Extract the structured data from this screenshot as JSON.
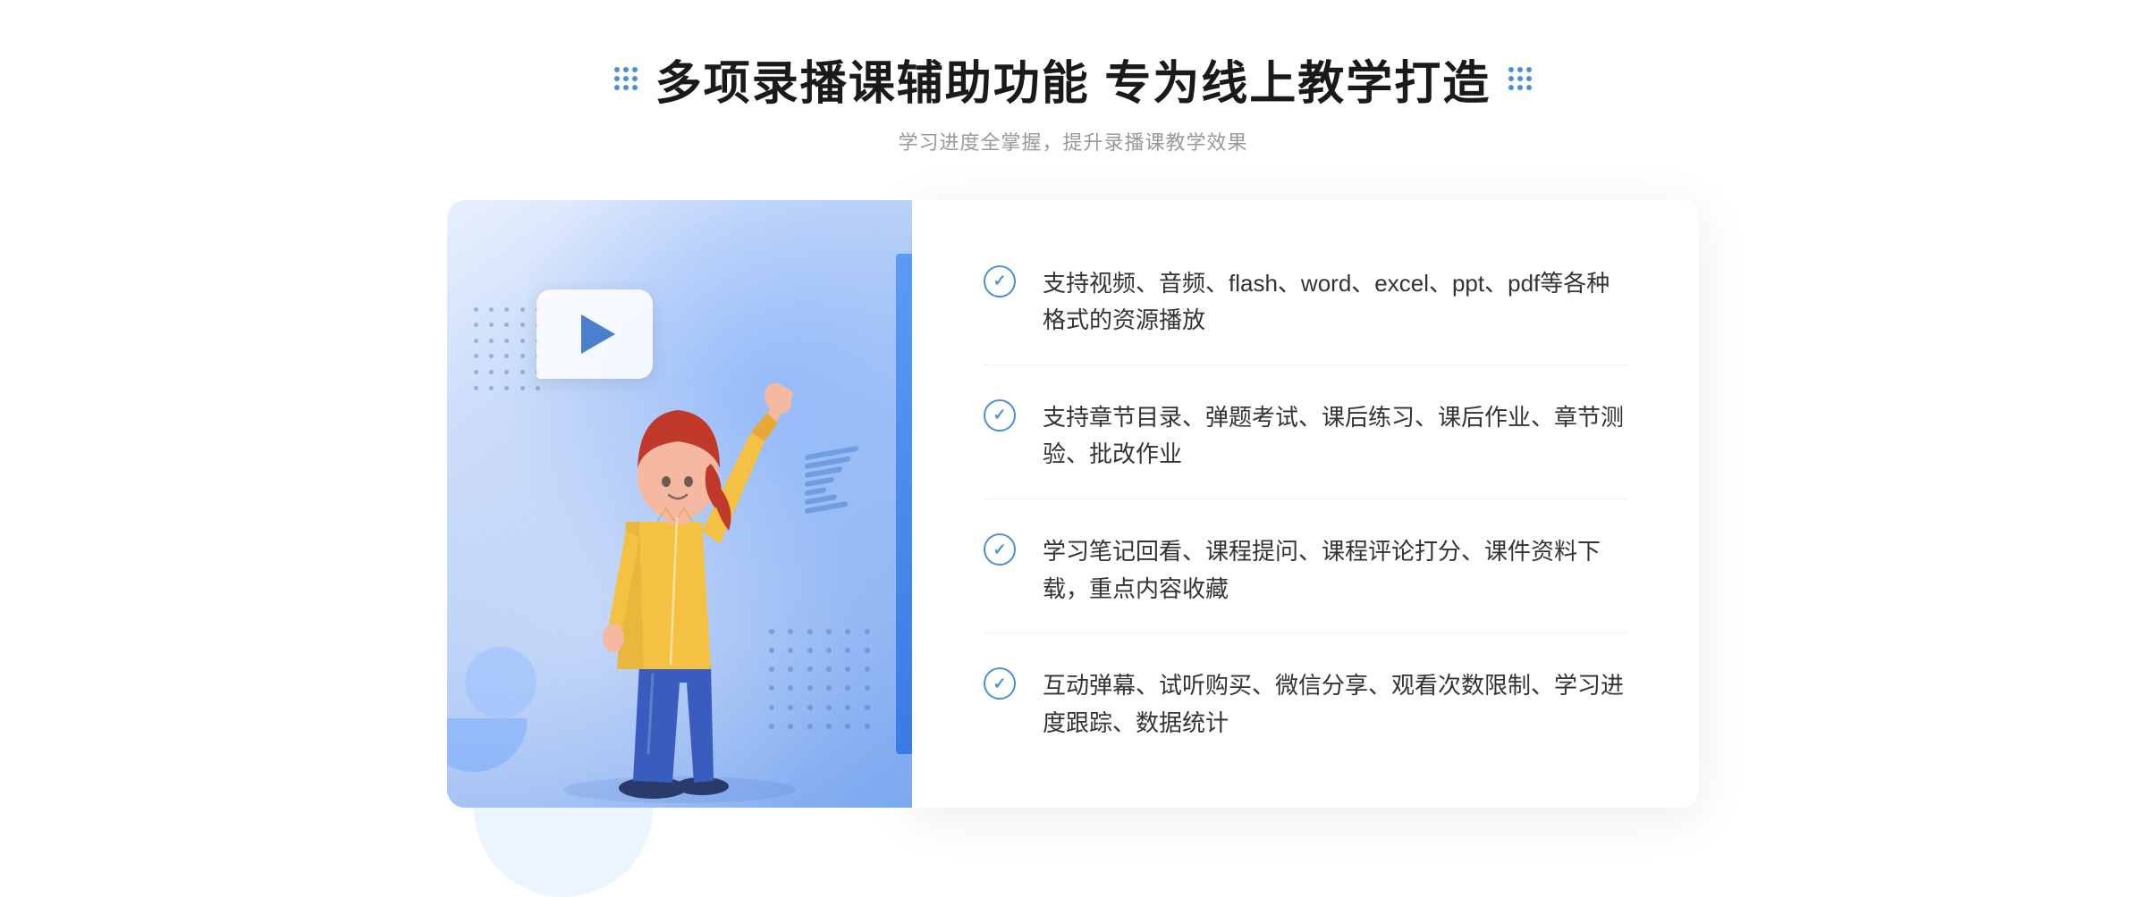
{
  "header": {
    "title": "多项录播课辅助功能 专为线上教学打造",
    "subtitle": "学习进度全掌握，提升录播课教学效果",
    "dot_decoration_left": "dots-left",
    "dot_decoration_right": "dots-right"
  },
  "features": [
    {
      "id": 1,
      "text": "支持视频、音频、flash、word、excel、ppt、pdf等各种格式的资源播放"
    },
    {
      "id": 2,
      "text": "支持章节目录、弹题考试、课后练习、课后作业、章节测验、批改作业"
    },
    {
      "id": 3,
      "text": "学习笔记回看、课程提问、课程评论打分、课件资料下载，重点内容收藏"
    },
    {
      "id": 4,
      "text": "互动弹幕、试听购买、微信分享、观看次数限制、学习进度跟踪、数据统计"
    }
  ],
  "colors": {
    "primary": "#4a90d9",
    "title": "#1a1a1a",
    "subtitle": "#999999",
    "feature_text": "#333333",
    "background": "#ffffff",
    "card_gradient_start": "#e8f0fe",
    "card_gradient_end": "#7ba8f0"
  },
  "icons": {
    "check": "✓",
    "chevron": "»",
    "play": "▶"
  }
}
